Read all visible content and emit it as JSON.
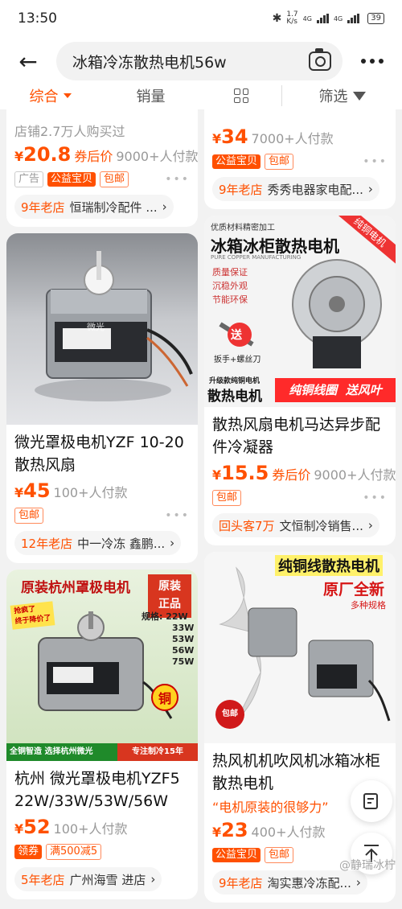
{
  "status_bar": {
    "time": "13:50",
    "net_speed": "1.7\nK/s",
    "sig1": "4G",
    "sig2": "4G",
    "battery": "39"
  },
  "search": {
    "query": "冰箱冷冻散热电机56w"
  },
  "sort_tabs": {
    "main": "综合",
    "sales": "销量",
    "filter": "筛选"
  },
  "products": [
    {
      "prefix": "店铺2.7万人购买过",
      "price": "20.8",
      "after": "券后价",
      "sold": "9000+人付款",
      "tags": [
        "广告",
        "公益宝贝",
        "包邮"
      ],
      "shop_age": "9年老店",
      "shop": "恒瑞制冷配件 ..."
    },
    {
      "price": "34",
      "sold": "7000+人付款",
      "tags": [
        "公益宝贝",
        "包邮"
      ],
      "shop_age": "9年老店",
      "shop": "秀秀电器家电配..."
    },
    {
      "title": "微光罩极电机YZF 10-20散热风扇",
      "img_label": "微光",
      "price": "45",
      "sold": "100+人付款",
      "tags": [
        "包邮"
      ],
      "shop_age": "12年老店",
      "shop": "中一冷冻 鑫鹏..."
    },
    {
      "title": "散热风扇电机马达异步配件冷凝器",
      "img_top": "优质材料精密加工",
      "img_ribbon": "纯铜电机",
      "img_headline": "冰箱冰柜散热电机",
      "img_sub": "PURE COPPER MANUFACTURING",
      "img_bullets": [
        "质量保证",
        "沉稳外观",
        "节能环保"
      ],
      "img_gift": "送",
      "img_gift_text": "扳手+螺丝刀",
      "img_bottom_small": "升级款纯铜电机",
      "img_bottom_big": "散热电机",
      "img_bottom_right": "纯铜线圈  送风叶",
      "price": "15.5",
      "after": "券后价",
      "sold": "9000+人付款",
      "tags": [
        "包邮"
      ],
      "shop_age": "回头客7万",
      "shop": "文恒制冷销售..."
    },
    {
      "title": "杭州 微光罩极电机YZF5 22W/33W/53W/56W",
      "img_title": "原装杭州罩极电机",
      "img_badge": "原装\n正品",
      "img_sticker": "抢疯了\n终于降价了",
      "img_spec_head": "规格: 22W",
      "img_specs": [
        "33W",
        "53W",
        "56W",
        "75W"
      ],
      "img_copper": "铜",
      "img_bl": "全铜智造 选择杭州微光",
      "img_br": "专注制冷15年",
      "price": "52",
      "sold": "100+人付款",
      "tags": [
        "领券",
        "满500减5"
      ],
      "shop_age": "5年老店",
      "shop": "广州海雪 进店"
    },
    {
      "title": "热风机机吹风机冰箱冰柜散热电机",
      "tagline": "“电机原装的很够力”",
      "img_title": "纯铜线散热电机",
      "img_red": "原厂全新",
      "img_small": "多种规格",
      "img_badge": "包邮",
      "price": "23",
      "sold": "400+人付款",
      "tags": [
        "公益宝贝",
        "包邮"
      ],
      "shop_age": "9年老店",
      "shop": "淘实惠冷冻配..."
    }
  ],
  "watermark": "@静瑞冰柠",
  "colors": {
    "accent": "#ff5000",
    "background": "#f2f2f2"
  }
}
